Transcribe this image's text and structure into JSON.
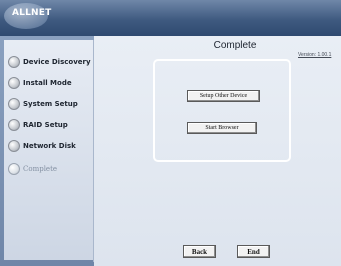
{
  "app": {
    "logo_text": "ALLNET"
  },
  "header": {
    "title": "Complete",
    "version": "Version: 1.00.1"
  },
  "steps": [
    {
      "label": "Device Discovery",
      "active": false
    },
    {
      "label": "Install Mode",
      "active": false
    },
    {
      "label": "System Setup",
      "active": false
    },
    {
      "label": "RAID Setup",
      "active": false
    },
    {
      "label": "Network Disk",
      "active": false
    },
    {
      "label": "Complete",
      "active": true
    }
  ],
  "actions": {
    "setup_other_device": "Setup Other Device",
    "start_browser": "Start Browser"
  },
  "footer": {
    "back_label": "Back",
    "end_label": "End"
  }
}
